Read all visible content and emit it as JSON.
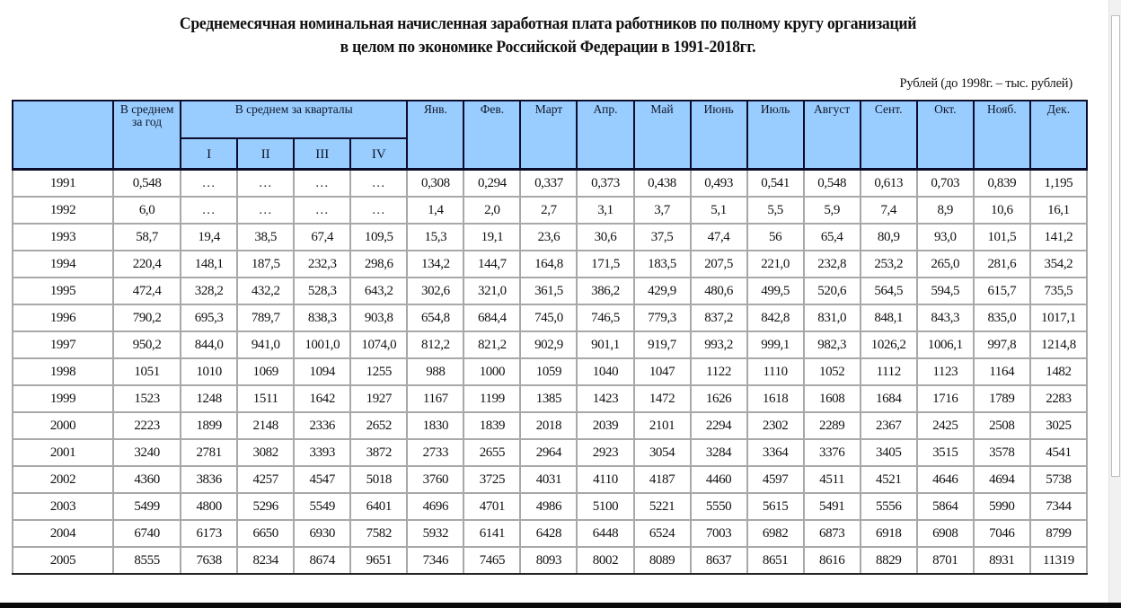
{
  "document": {
    "title_line1": "Среднемесячная номинальная начисленная заработная плата работников по полному кругу организаций",
    "title_line2": "в целом по экономике Российской Федерации в 1991-2018гг.",
    "units_note": "Рублей (до 1998г. – тыс. рублей)"
  },
  "table": {
    "header": {
      "annual_avg": "В среднем за год",
      "quarters_group": "В среднем за кварталы",
      "quarters": [
        "I",
        "II",
        "III",
        "IV"
      ],
      "months": [
        "Янв.",
        "Фев.",
        "Март",
        "Апр.",
        "Май",
        "Июнь",
        "Июль",
        "Август",
        "Сент.",
        "Окт.",
        "Нояб.",
        "Дек."
      ]
    },
    "rows": [
      {
        "year": "1991",
        "avg": "0,548",
        "q": [
          "…",
          "…",
          "…",
          "…"
        ],
        "m": [
          "0,308",
          "0,294",
          "0,337",
          "0,373",
          "0,438",
          "0,493",
          "0,541",
          "0,548",
          "0,613",
          "0,703",
          "0,839",
          "1,195"
        ]
      },
      {
        "year": "1992",
        "avg": "6,0",
        "q": [
          "…",
          "…",
          "…",
          "…"
        ],
        "m": [
          "1,4",
          "2,0",
          "2,7",
          "3,1",
          "3,7",
          "5,1",
          "5,5",
          "5,9",
          "7,4",
          "8,9",
          "10,6",
          "16,1"
        ]
      },
      {
        "year": "1993",
        "avg": "58,7",
        "q": [
          "19,4",
          "38,5",
          "67,4",
          "109,5"
        ],
        "m": [
          "15,3",
          "19,1",
          "23,6",
          "30,6",
          "37,5",
          "47,4",
          "56",
          "65,4",
          "80,9",
          "93,0",
          "101,5",
          "141,2"
        ]
      },
      {
        "year": "1994",
        "avg": "220,4",
        "q": [
          "148,1",
          "187,5",
          "232,3",
          "298,6"
        ],
        "m": [
          "134,2",
          "144,7",
          "164,8",
          "171,5",
          "183,5",
          "207,5",
          "221,0",
          "232,8",
          "253,2",
          "265,0",
          "281,6",
          "354,2"
        ]
      },
      {
        "year": "1995",
        "avg": "472,4",
        "q": [
          "328,2",
          "432,2",
          "528,3",
          "643,2"
        ],
        "m": [
          "302,6",
          "321,0",
          "361,5",
          "386,2",
          "429,9",
          "480,6",
          "499,5",
          "520,6",
          "564,5",
          "594,5",
          "615,7",
          "735,5"
        ]
      },
      {
        "year": "1996",
        "avg": "790,2",
        "q": [
          "695,3",
          "789,7",
          "838,3",
          "903,8"
        ],
        "m": [
          "654,8",
          "684,4",
          "745,0",
          "746,5",
          "779,3",
          "837,2",
          "842,8",
          "831,0",
          "848,1",
          "843,3",
          "835,0",
          "1017,1"
        ]
      },
      {
        "year": "1997",
        "avg": "950,2",
        "q": [
          "844,0",
          "941,0",
          "1001,0",
          "1074,0"
        ],
        "m": [
          "812,2",
          "821,2",
          "902,9",
          "901,1",
          "919,7",
          "993,2",
          "999,1",
          "982,3",
          "1026,2",
          "1006,1",
          "997,8",
          "1214,8"
        ]
      },
      {
        "year": "1998",
        "avg": "1051",
        "q": [
          "1010",
          "1069",
          "1094",
          "1255"
        ],
        "m": [
          "988",
          "1000",
          "1059",
          "1040",
          "1047",
          "1122",
          "1110",
          "1052",
          "1112",
          "1123",
          "1164",
          "1482"
        ]
      },
      {
        "year": "1999",
        "avg": "1523",
        "q": [
          "1248",
          "1511",
          "1642",
          "1927"
        ],
        "m": [
          "1167",
          "1199",
          "1385",
          "1423",
          "1472",
          "1626",
          "1618",
          "1608",
          "1684",
          "1716",
          "1789",
          "2283"
        ]
      },
      {
        "year": "2000",
        "avg": "2223",
        "q": [
          "1899",
          "2148",
          "2336",
          "2652"
        ],
        "m": [
          "1830",
          "1839",
          "2018",
          "2039",
          "2101",
          "2294",
          "2302",
          "2289",
          "2367",
          "2425",
          "2508",
          "3025"
        ]
      },
      {
        "year": "2001",
        "avg": "3240",
        "q": [
          "2781",
          "3082",
          "3393",
          "3872"
        ],
        "m": [
          "2733",
          "2655",
          "2964",
          "2923",
          "3054",
          "3284",
          "3364",
          "3376",
          "3405",
          "3515",
          "3578",
          "4541"
        ]
      },
      {
        "year": "2002",
        "avg": "4360",
        "q": [
          "3836",
          "4257",
          "4547",
          "5018"
        ],
        "m": [
          "3760",
          "3725",
          "4031",
          "4110",
          "4187",
          "4460",
          "4597",
          "4511",
          "4521",
          "4646",
          "4694",
          "5738"
        ]
      },
      {
        "year": "2003",
        "avg": "5499",
        "q": [
          "4800",
          "5296",
          "5549",
          "6401"
        ],
        "m": [
          "4696",
          "4701",
          "4986",
          "5100",
          "5221",
          "5550",
          "5615",
          "5491",
          "5556",
          "5864",
          "5990",
          "7344"
        ]
      },
      {
        "year": "2004",
        "avg": "6740",
        "q": [
          "6173",
          "6650",
          "6930",
          "7582"
        ],
        "m": [
          "5932",
          "6141",
          "6428",
          "6448",
          "6524",
          "7003",
          "6982",
          "6873",
          "6918",
          "6908",
          "7046",
          "8799"
        ]
      },
      {
        "year": "2005",
        "avg": "8555",
        "q": [
          "7638",
          "8234",
          "8674",
          "9651"
        ],
        "m": [
          "7346",
          "7465",
          "8093",
          "8002",
          "8089",
          "8637",
          "8651",
          "8616",
          "8829",
          "8701",
          "8931",
          "11319"
        ]
      }
    ]
  },
  "colors": {
    "header_bg": "#99ccff",
    "header_border": "#0b0b2a",
    "cell_border": "#a8a8a8"
  }
}
